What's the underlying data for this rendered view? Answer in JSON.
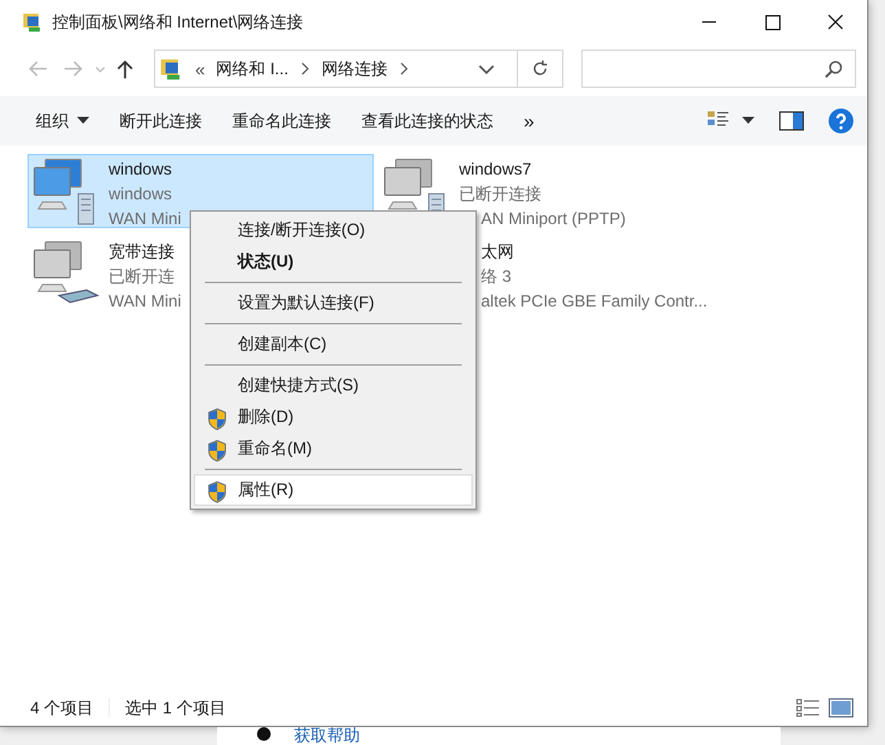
{
  "window": {
    "title": "控制面板\\网络和 Internet\\网络连接"
  },
  "address_bar": {
    "overflow": "«",
    "crumbs": [
      "网络和 I...",
      "网络连接"
    ]
  },
  "toolbar": {
    "items": [
      {
        "label": "组织",
        "dropdown": true
      },
      {
        "label": "断开此连接",
        "dropdown": false
      },
      {
        "label": "重命名此连接",
        "dropdown": false
      },
      {
        "label": "查看此连接的状态",
        "dropdown": false
      }
    ],
    "more": "»"
  },
  "connections": [
    {
      "name": "windows",
      "lines": [
        "windows",
        "WAN Mini"
      ],
      "kind": "vpn",
      "connected": true,
      "selected": true
    },
    {
      "name": "windows7",
      "lines": [
        "已断开连接",
        "AN Miniport (PPTP)"
      ],
      "kind": "vpn",
      "connected": false,
      "selected": false
    },
    {
      "name": "宽带连接",
      "lines": [
        "已断开连",
        "WAN Mini"
      ],
      "kind": "broadband",
      "connected": false,
      "selected": false
    },
    {
      "name": "太网",
      "lines": [
        "络 3",
        "altek PCIe GBE Family Contr..."
      ],
      "kind": "ethernet",
      "selected": false
    }
  ],
  "context_menu": [
    {
      "kind": "item",
      "label": "连接/断开连接(O)",
      "default": false,
      "shield": false,
      "selected": false
    },
    {
      "kind": "item",
      "label": "状态(U)",
      "default": true,
      "shield": false,
      "selected": false
    },
    {
      "kind": "separator"
    },
    {
      "kind": "item",
      "label": "设置为默认连接(F)",
      "default": false,
      "shield": false,
      "selected": false
    },
    {
      "kind": "separator"
    },
    {
      "kind": "item",
      "label": "创建副本(C)",
      "default": false,
      "shield": false,
      "selected": false
    },
    {
      "kind": "separator"
    },
    {
      "kind": "item",
      "label": "创建快捷方式(S)",
      "default": false,
      "shield": false,
      "selected": false
    },
    {
      "kind": "item",
      "label": "删除(D)",
      "default": false,
      "shield": true,
      "selected": false
    },
    {
      "kind": "item",
      "label": "重命名(M)",
      "default": false,
      "shield": true,
      "selected": false
    },
    {
      "kind": "separator"
    },
    {
      "kind": "item",
      "label": "属性(R)",
      "default": false,
      "shield": true,
      "selected": true
    }
  ],
  "status_bar": {
    "count": "4 个项目",
    "selection": "选中 1 个项目"
  },
  "background": {
    "link": "获取帮助"
  }
}
